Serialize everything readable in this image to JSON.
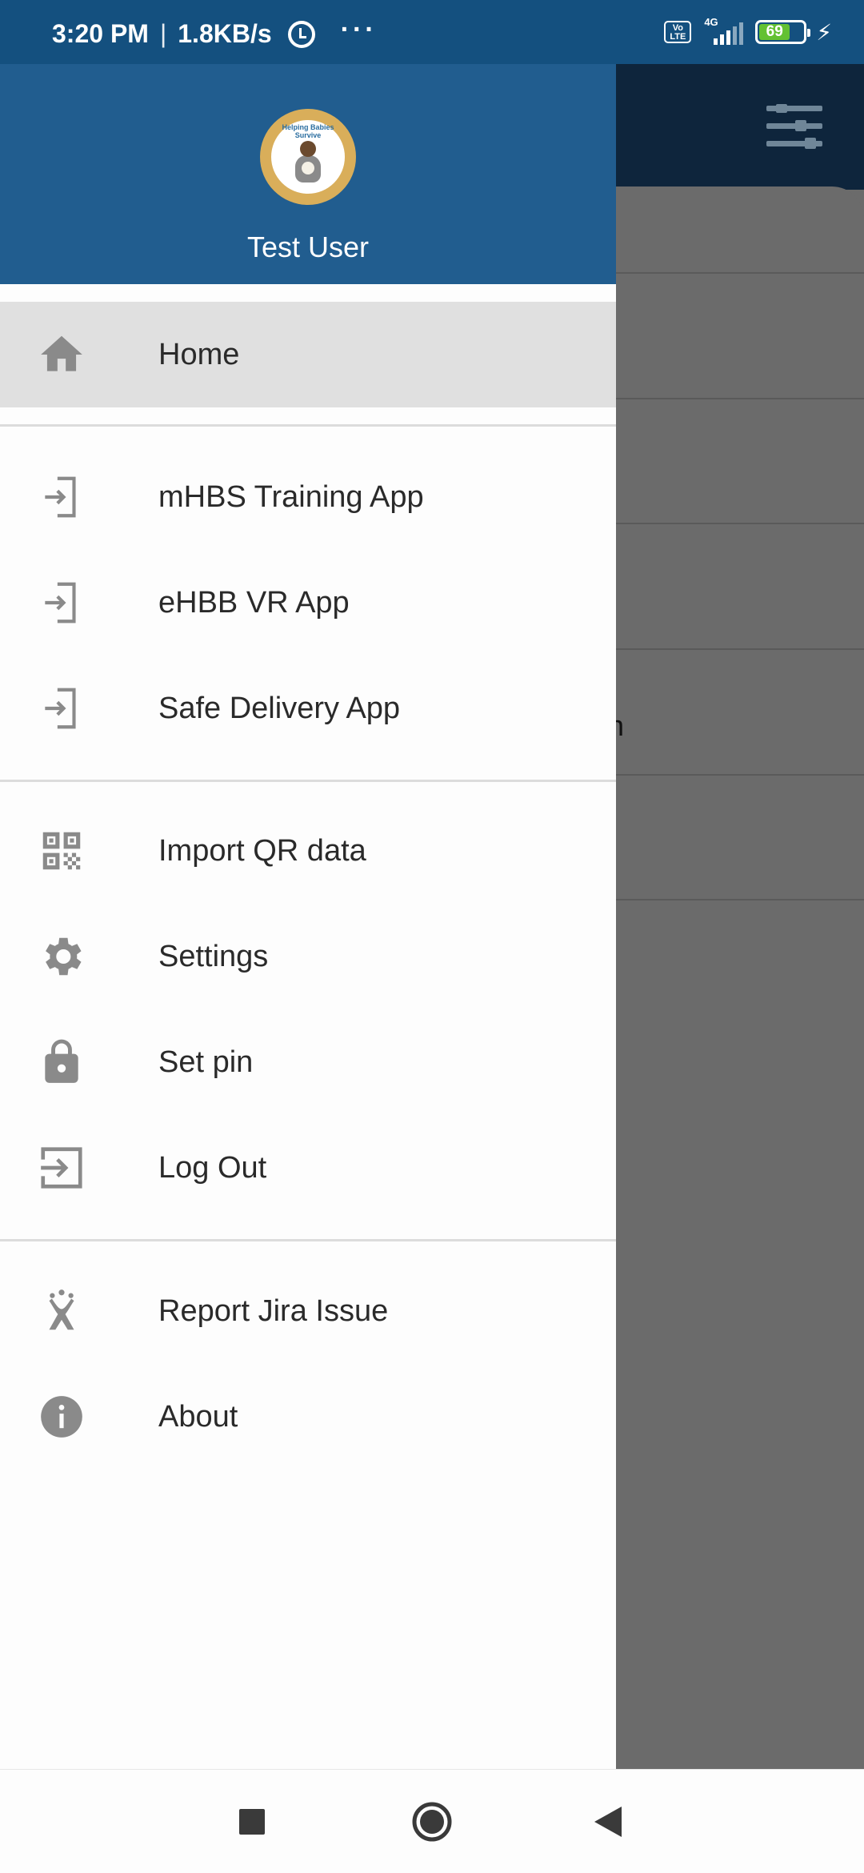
{
  "status_bar": {
    "time": "3:20 PM",
    "separator": "|",
    "speed": "1.8KB/s",
    "volte_label": "Vo LTE",
    "network_type": "4G",
    "battery_level": "69",
    "icons": [
      "alarm-icon",
      "more-dots-icon",
      "volte-icon",
      "signal-icon",
      "battery-icon",
      "charging-icon"
    ]
  },
  "drawer": {
    "user_name": "Test User",
    "logo_text": "Helping Babies Survive",
    "items": [
      {
        "label": "Home",
        "icon": "home-icon",
        "active": true
      },
      {
        "label": "mHBS Training App",
        "icon": "app-launch-icon"
      },
      {
        "label": "eHBB VR App",
        "icon": "app-launch-icon"
      },
      {
        "label": "Safe Delivery App",
        "icon": "app-launch-icon"
      },
      {
        "label": "Import QR data",
        "icon": "qr-code-icon"
      },
      {
        "label": "Settings",
        "icon": "gear-icon"
      },
      {
        "label": "Set pin",
        "icon": "lock-icon"
      },
      {
        "label": "Log Out",
        "icon": "logout-icon"
      },
      {
        "label": "Report Jira Issue",
        "icon": "jira-icon"
      },
      {
        "label": "About",
        "icon": "info-icon"
      }
    ]
  },
  "background": {
    "partial_text": "n"
  },
  "nav_bar": {
    "buttons": [
      "recents-button",
      "home-button",
      "back-button"
    ]
  },
  "colors": {
    "status_bar": "#14507f",
    "drawer_header": "#215d8f",
    "scrim": "#6b6b6b",
    "active_item": "#e0e0e0",
    "icon_gray": "#8a8a8a"
  }
}
